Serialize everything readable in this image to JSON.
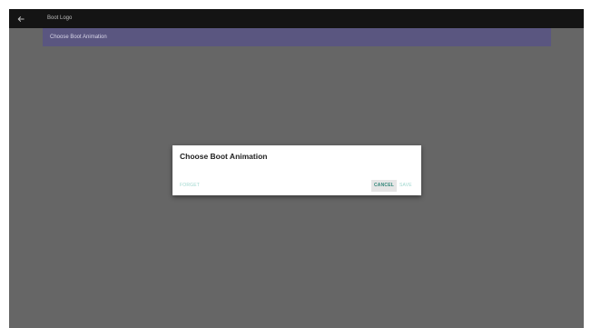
{
  "topbar": {
    "back_icon": "arrow-left-icon",
    "title": "Boot Logo"
  },
  "list": {
    "items": [
      {
        "label": "Choose Boot Animation"
      }
    ]
  },
  "dialog": {
    "title": "Choose Boot Animation",
    "buttons": {
      "forget": "FORGET",
      "cancel": "CANCEL",
      "save": "SAVE"
    }
  },
  "colors": {
    "topbar": "#141414",
    "background_dim": "#666666",
    "list_item_highlight": "#5a5680",
    "accent": "#33877a",
    "accent_disabled": "#9fd7ce"
  }
}
